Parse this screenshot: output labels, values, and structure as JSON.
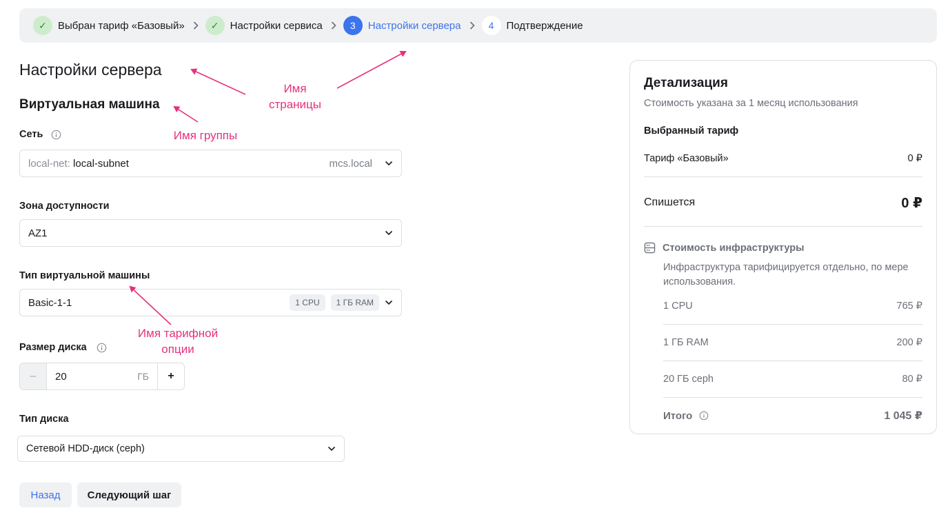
{
  "stepper": {
    "steps": [
      {
        "marker": "✓",
        "label": "Выбран тариф «Базовый»",
        "state": "done"
      },
      {
        "marker": "✓",
        "label": "Настройки сервиса",
        "state": "done"
      },
      {
        "marker": "3",
        "label": "Настройки сервера",
        "state": "current"
      },
      {
        "marker": "4",
        "label": "Подтверждение",
        "state": "future"
      }
    ]
  },
  "page_title": "Настройки сервера",
  "group_title": "Виртуальная машина",
  "network": {
    "label": "Сеть",
    "prefix": "local-net:",
    "value": "local-subnet",
    "domain": "mcs.local"
  },
  "zone": {
    "label": "Зона доступности",
    "value": "AZ1"
  },
  "vm_type": {
    "label": "Тип виртуальной машины",
    "value": "Basic-1-1",
    "chips": [
      "1 CPU",
      "1 ГБ RAM"
    ]
  },
  "disk_size": {
    "label": "Размер диска",
    "minus": "–",
    "value": "20",
    "unit": "ГБ",
    "plus": "+"
  },
  "disk_type": {
    "label": "Тип диска",
    "value": "Сетевой HDD-диск (ceph)"
  },
  "buttons": {
    "back": "Назад",
    "next": "Следующий шаг"
  },
  "annotations": {
    "page_name": "Имя\nстраницы",
    "group_name": "Имя группы",
    "tariff_option_name": "Имя тарифной\nопции"
  },
  "summary": {
    "title": "Детализация",
    "subtitle": "Стоимость указана за 1 месяц использования",
    "section": "Выбранный тариф",
    "tariff_label": "Тариф «Базовый»",
    "tariff_price": "0 ₽",
    "charge_label": "Спишется",
    "charge_value": "0 ₽",
    "infra_title": "Стоимость инфраструктуры",
    "infra_desc": "Инфраструктура тарифицируется отдельно, по мере использования.",
    "infra_rows": [
      {
        "label": "1 CPU",
        "price": "765 ₽"
      },
      {
        "label": "1 ГБ RAM",
        "price": "200 ₽"
      },
      {
        "label": "20 ГБ ceph",
        "price": "80 ₽"
      }
    ],
    "total_label": "Итого",
    "total_value": "1 045 ₽"
  },
  "colors": {
    "accent": "#3b74ec",
    "done": "#cdeccc",
    "annotation": "#e5317c"
  }
}
